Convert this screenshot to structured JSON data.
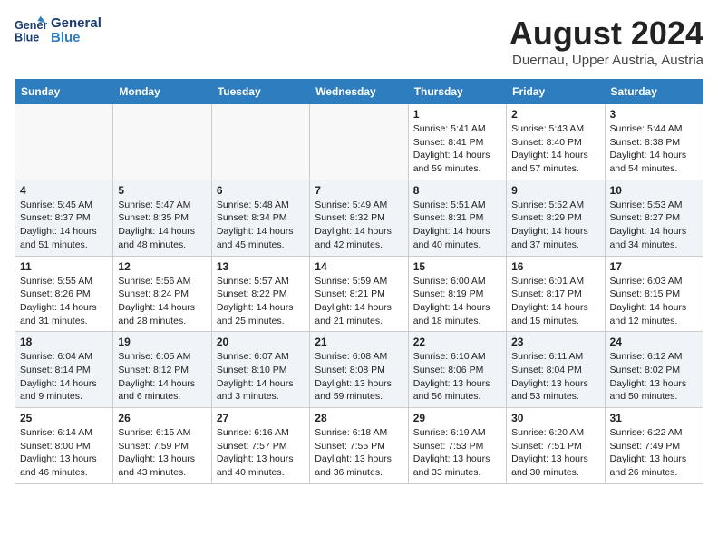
{
  "header": {
    "logo_line1": "General",
    "logo_line2": "Blue",
    "month_year": "August 2024",
    "location": "Duernau, Upper Austria, Austria"
  },
  "days_of_week": [
    "Sunday",
    "Monday",
    "Tuesday",
    "Wednesday",
    "Thursday",
    "Friday",
    "Saturday"
  ],
  "weeks": [
    [
      null,
      null,
      null,
      null,
      {
        "day": 1,
        "sunrise": "5:41 AM",
        "sunset": "8:41 PM",
        "daylight": "14 hours and 59 minutes."
      },
      {
        "day": 2,
        "sunrise": "5:43 AM",
        "sunset": "8:40 PM",
        "daylight": "14 hours and 57 minutes."
      },
      {
        "day": 3,
        "sunrise": "5:44 AM",
        "sunset": "8:38 PM",
        "daylight": "14 hours and 54 minutes."
      }
    ],
    [
      {
        "day": 4,
        "sunrise": "5:45 AM",
        "sunset": "8:37 PM",
        "daylight": "14 hours and 51 minutes."
      },
      {
        "day": 5,
        "sunrise": "5:47 AM",
        "sunset": "8:35 PM",
        "daylight": "14 hours and 48 minutes."
      },
      {
        "day": 6,
        "sunrise": "5:48 AM",
        "sunset": "8:34 PM",
        "daylight": "14 hours and 45 minutes."
      },
      {
        "day": 7,
        "sunrise": "5:49 AM",
        "sunset": "8:32 PM",
        "daylight": "14 hours and 42 minutes."
      },
      {
        "day": 8,
        "sunrise": "5:51 AM",
        "sunset": "8:31 PM",
        "daylight": "14 hours and 40 minutes."
      },
      {
        "day": 9,
        "sunrise": "5:52 AM",
        "sunset": "8:29 PM",
        "daylight": "14 hours and 37 minutes."
      },
      {
        "day": 10,
        "sunrise": "5:53 AM",
        "sunset": "8:27 PM",
        "daylight": "14 hours and 34 minutes."
      }
    ],
    [
      {
        "day": 11,
        "sunrise": "5:55 AM",
        "sunset": "8:26 PM",
        "daylight": "14 hours and 31 minutes."
      },
      {
        "day": 12,
        "sunrise": "5:56 AM",
        "sunset": "8:24 PM",
        "daylight": "14 hours and 28 minutes."
      },
      {
        "day": 13,
        "sunrise": "5:57 AM",
        "sunset": "8:22 PM",
        "daylight": "14 hours and 25 minutes."
      },
      {
        "day": 14,
        "sunrise": "5:59 AM",
        "sunset": "8:21 PM",
        "daylight": "14 hours and 21 minutes."
      },
      {
        "day": 15,
        "sunrise": "6:00 AM",
        "sunset": "8:19 PM",
        "daylight": "14 hours and 18 minutes."
      },
      {
        "day": 16,
        "sunrise": "6:01 AM",
        "sunset": "8:17 PM",
        "daylight": "14 hours and 15 minutes."
      },
      {
        "day": 17,
        "sunrise": "6:03 AM",
        "sunset": "8:15 PM",
        "daylight": "14 hours and 12 minutes."
      }
    ],
    [
      {
        "day": 18,
        "sunrise": "6:04 AM",
        "sunset": "8:14 PM",
        "daylight": "14 hours and 9 minutes."
      },
      {
        "day": 19,
        "sunrise": "6:05 AM",
        "sunset": "8:12 PM",
        "daylight": "14 hours and 6 minutes."
      },
      {
        "day": 20,
        "sunrise": "6:07 AM",
        "sunset": "8:10 PM",
        "daylight": "14 hours and 3 minutes."
      },
      {
        "day": 21,
        "sunrise": "6:08 AM",
        "sunset": "8:08 PM",
        "daylight": "13 hours and 59 minutes."
      },
      {
        "day": 22,
        "sunrise": "6:10 AM",
        "sunset": "8:06 PM",
        "daylight": "13 hours and 56 minutes."
      },
      {
        "day": 23,
        "sunrise": "6:11 AM",
        "sunset": "8:04 PM",
        "daylight": "13 hours and 53 minutes."
      },
      {
        "day": 24,
        "sunrise": "6:12 AM",
        "sunset": "8:02 PM",
        "daylight": "13 hours and 50 minutes."
      }
    ],
    [
      {
        "day": 25,
        "sunrise": "6:14 AM",
        "sunset": "8:00 PM",
        "daylight": "13 hours and 46 minutes."
      },
      {
        "day": 26,
        "sunrise": "6:15 AM",
        "sunset": "7:59 PM",
        "daylight": "13 hours and 43 minutes."
      },
      {
        "day": 27,
        "sunrise": "6:16 AM",
        "sunset": "7:57 PM",
        "daylight": "13 hours and 40 minutes."
      },
      {
        "day": 28,
        "sunrise": "6:18 AM",
        "sunset": "7:55 PM",
        "daylight": "13 hours and 36 minutes."
      },
      {
        "day": 29,
        "sunrise": "6:19 AM",
        "sunset": "7:53 PM",
        "daylight": "13 hours and 33 minutes."
      },
      {
        "day": 30,
        "sunrise": "6:20 AM",
        "sunset": "7:51 PM",
        "daylight": "13 hours and 30 minutes."
      },
      {
        "day": 31,
        "sunrise": "6:22 AM",
        "sunset": "7:49 PM",
        "daylight": "13 hours and 26 minutes."
      }
    ]
  ],
  "labels": {
    "sunrise_prefix": "Sunrise: ",
    "sunset_prefix": "Sunset: ",
    "daylight_prefix": "Daylight: "
  }
}
